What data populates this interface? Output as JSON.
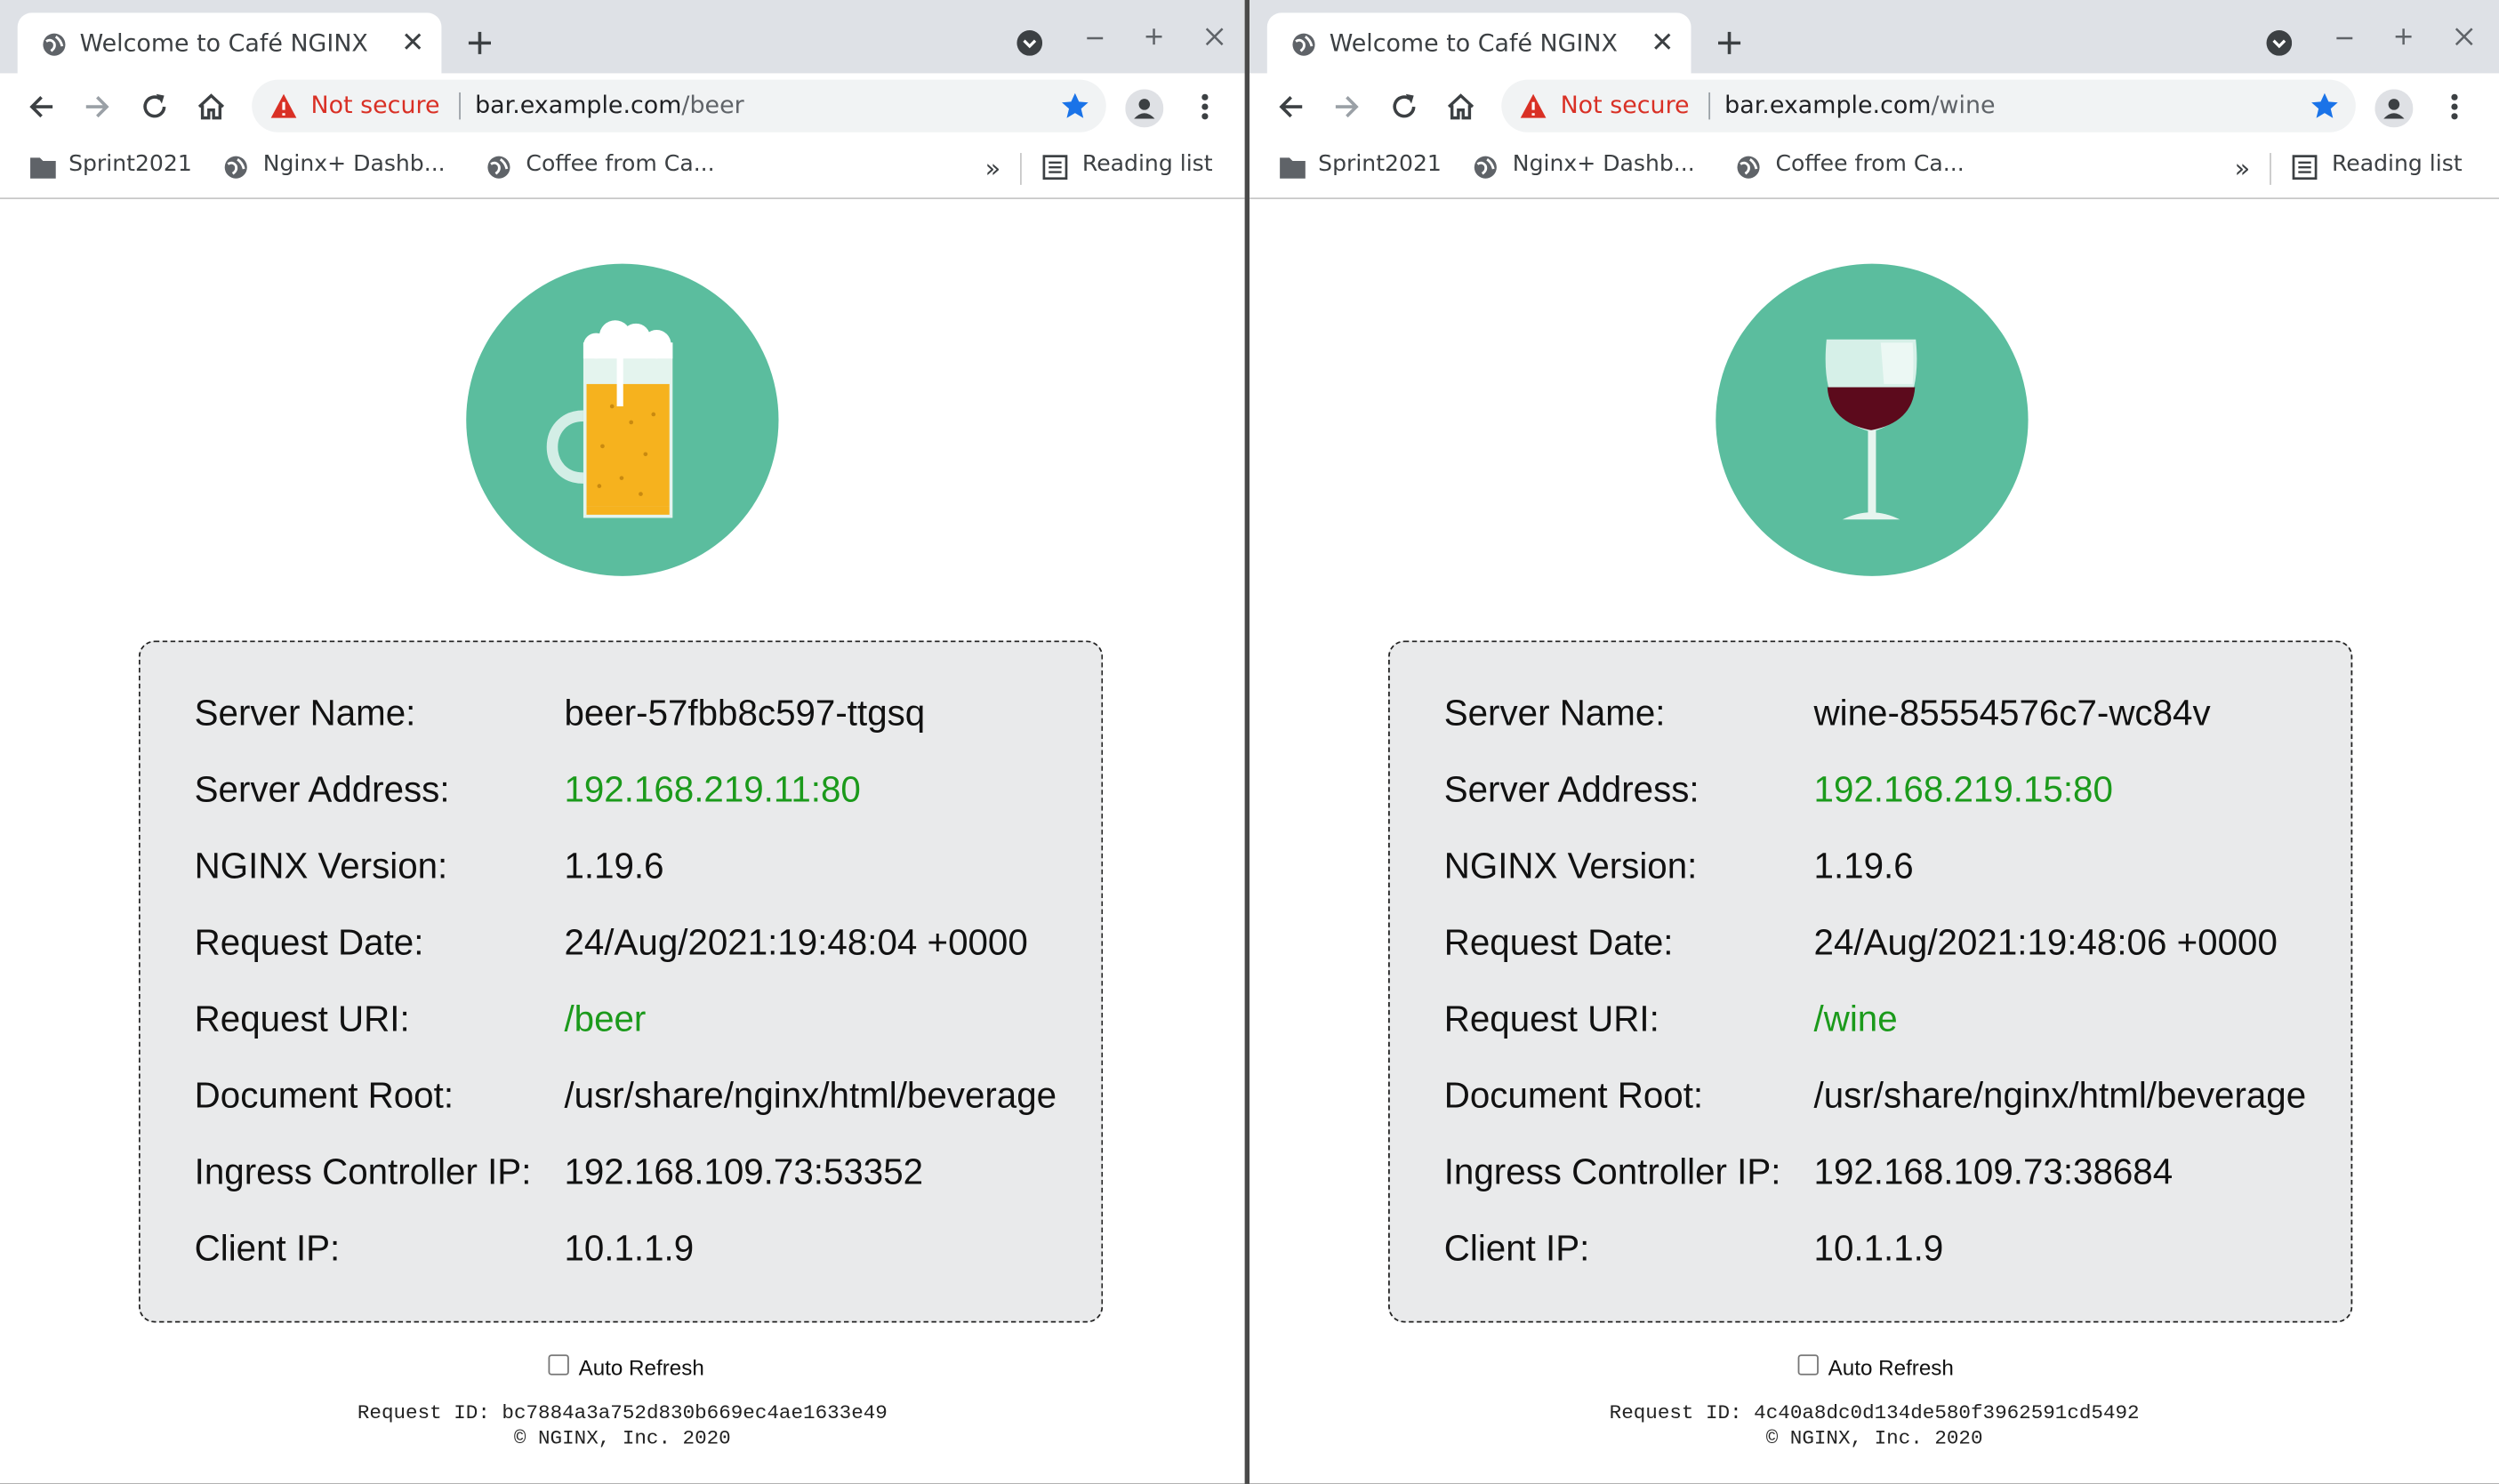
{
  "colors": {
    "accent_green": "#1b9a1b",
    "logo_circle": "#5bbd9e",
    "warning_red": "#d93025",
    "star_blue": "#1a73e8"
  },
  "windows": [
    {
      "tab": {
        "title": "Welcome to Café NGINX",
        "favicon": "globe-icon"
      },
      "omnibox": {
        "security": "Not secure",
        "host": "bar.example.com",
        "path": "/beer"
      },
      "bookmarks": {
        "items": [
          {
            "label": "Sprint2021",
            "icon": "folder-icon"
          },
          {
            "label": "Nginx+ Dashb...",
            "icon": "globe-icon"
          },
          {
            "label": "Coffee from Ca...",
            "icon": "globe-icon"
          }
        ],
        "more": "»",
        "reading_list": "Reading list"
      },
      "page": {
        "logo": "beer-mug-icon",
        "fields": [
          {
            "label": "Server Name:",
            "value": "beer-57fbb8c597-ttgsq"
          },
          {
            "label": "Server Address:",
            "value": "192.168.219.11:80"
          },
          {
            "label": "NGINX Version:",
            "value": "1.19.6"
          },
          {
            "label": "Request Date:",
            "value": "24/Aug/2021:19:48:04 +0000"
          },
          {
            "label": "Request URI:",
            "value": "/beer"
          },
          {
            "label": "Document Root:",
            "value": "/usr/share/nginx/html/beverage"
          },
          {
            "label": "Ingress Controller IP:",
            "value": "192.168.109.73:53352"
          },
          {
            "label": "Client IP:",
            "value": "10.1.1.9"
          }
        ],
        "auto_refresh_label": "Auto Refresh",
        "auto_refresh_checked": false,
        "request_id": "Request ID: bc7884a3a752d830b669ec4ae1633e49",
        "copyright": "© NGINX, Inc. 2020"
      }
    },
    {
      "tab": {
        "title": "Welcome to Café NGINX",
        "favicon": "globe-icon"
      },
      "omnibox": {
        "security": "Not secure",
        "host": "bar.example.com",
        "path": "/wine"
      },
      "bookmarks": {
        "items": [
          {
            "label": "Sprint2021",
            "icon": "folder-icon"
          },
          {
            "label": "Nginx+ Dashb...",
            "icon": "globe-icon"
          },
          {
            "label": "Coffee from Ca...",
            "icon": "globe-icon"
          }
        ],
        "more": "»",
        "reading_list": "Reading list"
      },
      "page": {
        "logo": "wine-glass-icon",
        "fields": [
          {
            "label": "Server Name:",
            "value": "wine-85554576c7-wc84v"
          },
          {
            "label": "Server Address:",
            "value": "192.168.219.15:80"
          },
          {
            "label": "NGINX Version:",
            "value": "1.19.6"
          },
          {
            "label": "Request Date:",
            "value": "24/Aug/2021:19:48:06 +0000"
          },
          {
            "label": "Request URI:",
            "value": "/wine"
          },
          {
            "label": "Document Root:",
            "value": "/usr/share/nginx/html/beverage"
          },
          {
            "label": "Ingress Controller IP:",
            "value": "192.168.109.73:38684"
          },
          {
            "label": "Client IP:",
            "value": "10.1.1.9"
          }
        ],
        "auto_refresh_label": "Auto Refresh",
        "auto_refresh_checked": false,
        "request_id": "Request ID: 4c40a8dc0d134de580f3962591cd5492",
        "copyright": "© NGINX, Inc. 2020"
      }
    }
  ]
}
